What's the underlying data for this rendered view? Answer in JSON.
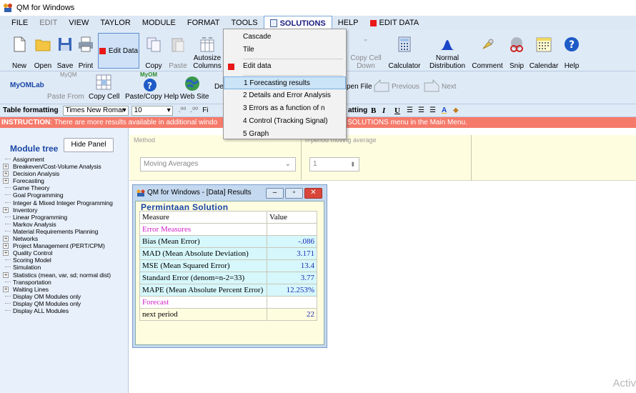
{
  "window": {
    "title": "QM for Windows"
  },
  "menu": {
    "file": "FILE",
    "edit": "EDIT",
    "view": "VIEW",
    "taylor": "TAYLOR",
    "module": "MODULE",
    "format": "FORMAT",
    "tools": "TOOLS",
    "solutions": "SOLUTIONS",
    "help": "HELP",
    "edit_data": "EDIT DATA"
  },
  "toolbar": {
    "new": "New",
    "open": "Open",
    "save": "Save",
    "print": "Print",
    "edit_data": "Edit Data",
    "copy": "Copy",
    "paste": "Paste",
    "autosize": "Autosize",
    "columns": "Columns",
    "copy_cell": "Copy Cell",
    "down": "Down",
    "calculator": "Calculator",
    "normal": "Normal",
    "distribution": "Distribution",
    "comment": "Comment",
    "snip": "Snip",
    "calendar": "Calendar",
    "help": "Help"
  },
  "toolbar2": {
    "myomlab": "MyOMLab",
    "myqm_small": "MyQM",
    "paste_from": "Paste From",
    "copy_cell": "Copy Cell",
    "paste_copy_help": "Paste/Copy Help",
    "myom_small": "MyOM",
    "web_site": "Web Site",
    "de": "De",
    "open_file": "pen File",
    "previous": "Previous",
    "next": "Next"
  },
  "format_bar": {
    "label": "Table formatting",
    "font": "Times New Romar",
    "size": "10",
    "fi": "Fi",
    "formatting": "atting",
    "bold": "B",
    "italic": "I",
    "underline": "U"
  },
  "instruction": {
    "prefix": "INSTRUCTION",
    "text": ": There are more results available in additional windo",
    "tail": "SOLUTIONS menu in the Main Menu."
  },
  "sidebar": {
    "title": "Module tree",
    "hide_button": "Hide Panel",
    "items": [
      {
        "label": "Assignment",
        "expandable": false
      },
      {
        "label": "Breakeven/Cost-Volume Analysis",
        "expandable": true
      },
      {
        "label": "Decision Analysis",
        "expandable": true
      },
      {
        "label": "Forecasting",
        "expandable": true
      },
      {
        "label": "Game Theory",
        "expandable": false
      },
      {
        "label": "Goal Programming",
        "expandable": false
      },
      {
        "label": "Integer & Mixed Integer Programming",
        "expandable": false
      },
      {
        "label": "Inventory",
        "expandable": true
      },
      {
        "label": "Linear Programming",
        "expandable": false
      },
      {
        "label": "Markov Analysis",
        "expandable": false
      },
      {
        "label": "Material Requirements Planning",
        "expandable": false
      },
      {
        "label": "Networks",
        "expandable": true
      },
      {
        "label": "Project Management (PERT/CPM)",
        "expandable": true
      },
      {
        "label": "Quality Control",
        "expandable": true
      },
      {
        "label": "Scoring Model",
        "expandable": false
      },
      {
        "label": "Simulation",
        "expandable": false
      },
      {
        "label": "Statistics (mean, var, sd; normal dist)",
        "expandable": true
      },
      {
        "label": "Transportation",
        "expandable": false
      },
      {
        "label": "Waiting Lines",
        "expandable": true
      },
      {
        "label": "Display OM Modules only",
        "expandable": false
      },
      {
        "label": "Display QM Modules only",
        "expandable": false
      },
      {
        "label": "Display ALL Modules",
        "expandable": false
      }
    ]
  },
  "method_panel": {
    "method_label": "Method",
    "method_value": "Moving Averages",
    "periods_label": "n-period moving average",
    "periods_value": "1"
  },
  "solutions_menu": {
    "items": [
      "Cascade",
      "Tile",
      "Edit data",
      "1 Forecasting results",
      "2 Details and Error Analysis",
      "3 Errors as a function of n",
      "4 Control (Tracking Signal)",
      "5 Graph"
    ],
    "selected": "1 Forecasting results"
  },
  "results_window": {
    "title": "QM for Windows - [Data] Results",
    "heading": "Permintaan  Solution",
    "col_measure": "Measure",
    "col_value": "Value",
    "section_errors": "Error Measures",
    "rows": [
      {
        "measure": "Bias (Mean Error)",
        "value": "-.086"
      },
      {
        "measure": "MAD (Mean Absolute Deviation)",
        "value": "3.171"
      },
      {
        "measure": "MSE (Mean Squared Error)",
        "value": "13.4"
      },
      {
        "measure": "Standard Error (denom=n-2=33)",
        "value": "3.77"
      },
      {
        "measure": "MAPE (Mean Absolute Percent Error)",
        "value": "12.253%"
      }
    ],
    "section_forecast": "Forecast",
    "forecast_row": {
      "measure": "next period",
      "value": "22"
    }
  },
  "watermark": "Activ"
}
